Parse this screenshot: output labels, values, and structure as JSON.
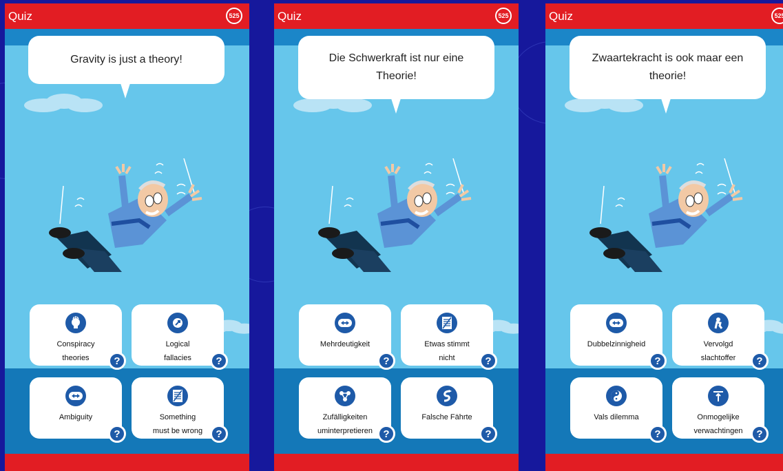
{
  "screens": [
    {
      "app_title": "Quiz",
      "score": "525",
      "statement": "Gravity is just a theory!",
      "answers": [
        {
          "label": "Conspiracy\ntheories",
          "icon": "conspiracy-icon"
        },
        {
          "label": "Logical\nfallacies",
          "icon": "fallacy-icon"
        },
        {
          "label": "Ambiguity",
          "icon": "ambiguity-arrows-icon"
        },
        {
          "label": "Something\nmust be wrong",
          "icon": "document-icon"
        }
      ],
      "help_label": "?"
    },
    {
      "app_title": "Quiz",
      "score": "525",
      "statement": "Die Schwerkraft ist nur eine Theorie!",
      "answers": [
        {
          "label": "Mehrdeutigkeit",
          "icon": "ambiguity-arrows-icon"
        },
        {
          "label": "Etwas stimmt\nnicht",
          "icon": "document-icon"
        },
        {
          "label": "Zufälligkeiten\numinterpretieren",
          "icon": "network-icon"
        },
        {
          "label": "Falsche Fährte",
          "icon": "red-herring-icon"
        }
      ],
      "help_label": "?"
    },
    {
      "app_title": "Quiz",
      "score": "525",
      "statement": "Zwaartekracht is ook maar een theorie!",
      "answers": [
        {
          "label": "Dubbelzinnigheid",
          "icon": "ambiguity-arrows-icon"
        },
        {
          "label": "Vervolgd\nslachtoffer",
          "icon": "victim-icon"
        },
        {
          "label": "Vals dilemma",
          "icon": "yin-yang-icon"
        },
        {
          "label": "Onmogelijke\nverwachtingen",
          "icon": "impossible-expectations-icon"
        }
      ],
      "help_label": "?"
    }
  ],
  "colors": {
    "red": "#e21d23",
    "sky": "#66c6eb",
    "deep_blue": "#1e5aa8",
    "background": "#16189c"
  }
}
